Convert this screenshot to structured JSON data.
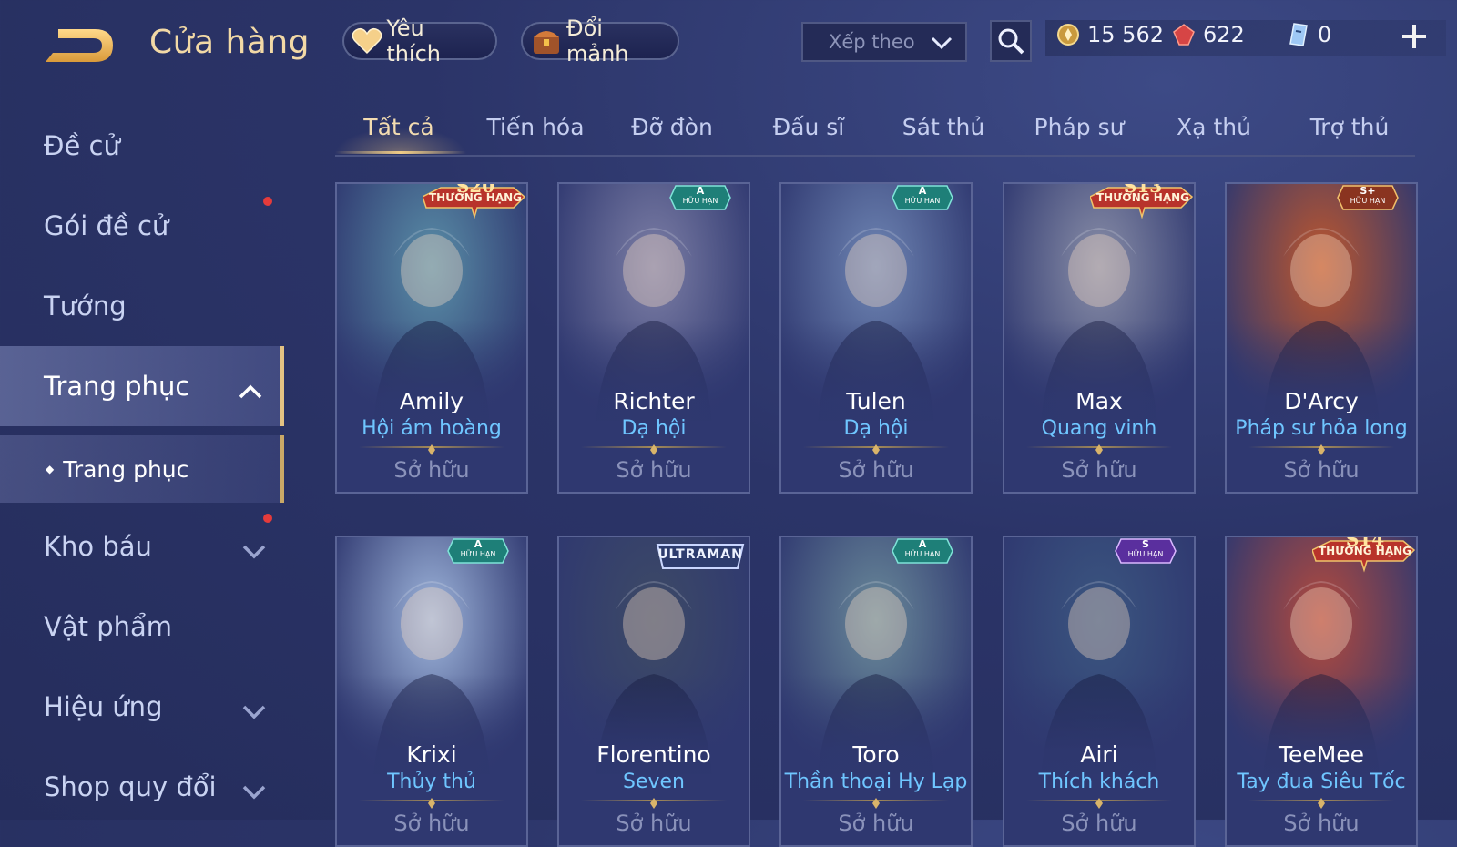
{
  "header": {
    "title": "Cửa hàng",
    "favorite_label": "Yêu thích",
    "exchange_label": "Đổi mảnh",
    "sort_placeholder": "Xếp theo"
  },
  "currency": {
    "gold": "15 562",
    "ruby": "622",
    "voucher": "0"
  },
  "sidebar": {
    "items": [
      {
        "label": "Đề cử"
      },
      {
        "label": "Gói đề cử"
      },
      {
        "label": "Tướng"
      },
      {
        "label": "Trang phục"
      },
      {
        "label": "Trang phục"
      },
      {
        "label": "Kho báu"
      },
      {
        "label": "Vật phẩm"
      },
      {
        "label": "Hiệu ứng"
      },
      {
        "label": "Shop quy đổi"
      }
    ]
  },
  "tabs": [
    {
      "label": "Tất cả"
    },
    {
      "label": "Tiến hóa"
    },
    {
      "label": "Đỡ đòn"
    },
    {
      "label": "Đấu sĩ"
    },
    {
      "label": "Sát thủ"
    },
    {
      "label": "Pháp sư"
    },
    {
      "label": "Xạ thủ"
    },
    {
      "label": "Trợ thủ"
    }
  ],
  "cards": [
    {
      "hero": "Amily",
      "skin": "Hội ám hoàng",
      "status": "Sở hữu",
      "badge_tier": "S20",
      "badge_text": "THƯỞNG HẠNG",
      "badge_kind": "season",
      "art_color": "#5a8fa8"
    },
    {
      "hero": "Richter",
      "skin": "Dạ hội",
      "status": "Sở hữu",
      "badge_tier": "A",
      "badge_text": "HỮU HẠN",
      "badge_kind": "limited",
      "art_color": "#7d7fa6"
    },
    {
      "hero": "Tulen",
      "skin": "Dạ hội",
      "status": "Sở hữu",
      "badge_tier": "A",
      "badge_text": "HỮU HẠN",
      "badge_kind": "limited",
      "art_color": "#6f86b4"
    },
    {
      "hero": "Max",
      "skin": "Quang vinh",
      "status": "Sở hữu",
      "badge_tier": "S13",
      "badge_text": "THƯỞNG HẠNG",
      "badge_kind": "season",
      "art_color": "#8a8fa8"
    },
    {
      "hero": "D'Arcy",
      "skin": "Pháp sư hỏa long",
      "status": "Sở hữu",
      "badge_tier": "S+",
      "badge_text": "HỮU HẠN",
      "badge_kind": "limited-gold",
      "art_color": "#c0572c"
    },
    {
      "hero": "Krixi",
      "skin": "Thủy thủ",
      "status": "Sở hữu",
      "badge_tier": "A",
      "badge_text": "HỮU HẠN",
      "badge_kind": "limited",
      "art_color": "#9fb6dc"
    },
    {
      "hero": "Florentino",
      "skin": "Seven",
      "status": "Sở hữu",
      "badge_tier": "",
      "badge_text": "ULTRAMAN",
      "badge_kind": "collab",
      "art_color": "#3d4a66"
    },
    {
      "hero": "Toro",
      "skin": "Thần thoại Hy Lạp",
      "status": "Sở hữu",
      "badge_tier": "A",
      "badge_text": "HỮU HẠN",
      "badge_kind": "limited",
      "art_color": "#6a8a9a"
    },
    {
      "hero": "Airi",
      "skin": "Thích khách",
      "status": "Sở hữu",
      "badge_tier": "S",
      "badge_text": "HỮU HẠN",
      "badge_kind": "limited-purple",
      "art_color": "#3b5680"
    },
    {
      "hero": "TeeMee",
      "skin": "Tay đua Siêu Tốc",
      "status": "Sở hữu",
      "badge_tier": "S14",
      "badge_text": "THƯỞNG HẠNG",
      "badge_kind": "season",
      "art_color": "#b54a3c"
    }
  ],
  "colors": {
    "accent_gold": "#f0cc86",
    "skin_name_blue": "#6fc6ff",
    "background": "#2b3468",
    "notification_red": "#e53b3b"
  }
}
